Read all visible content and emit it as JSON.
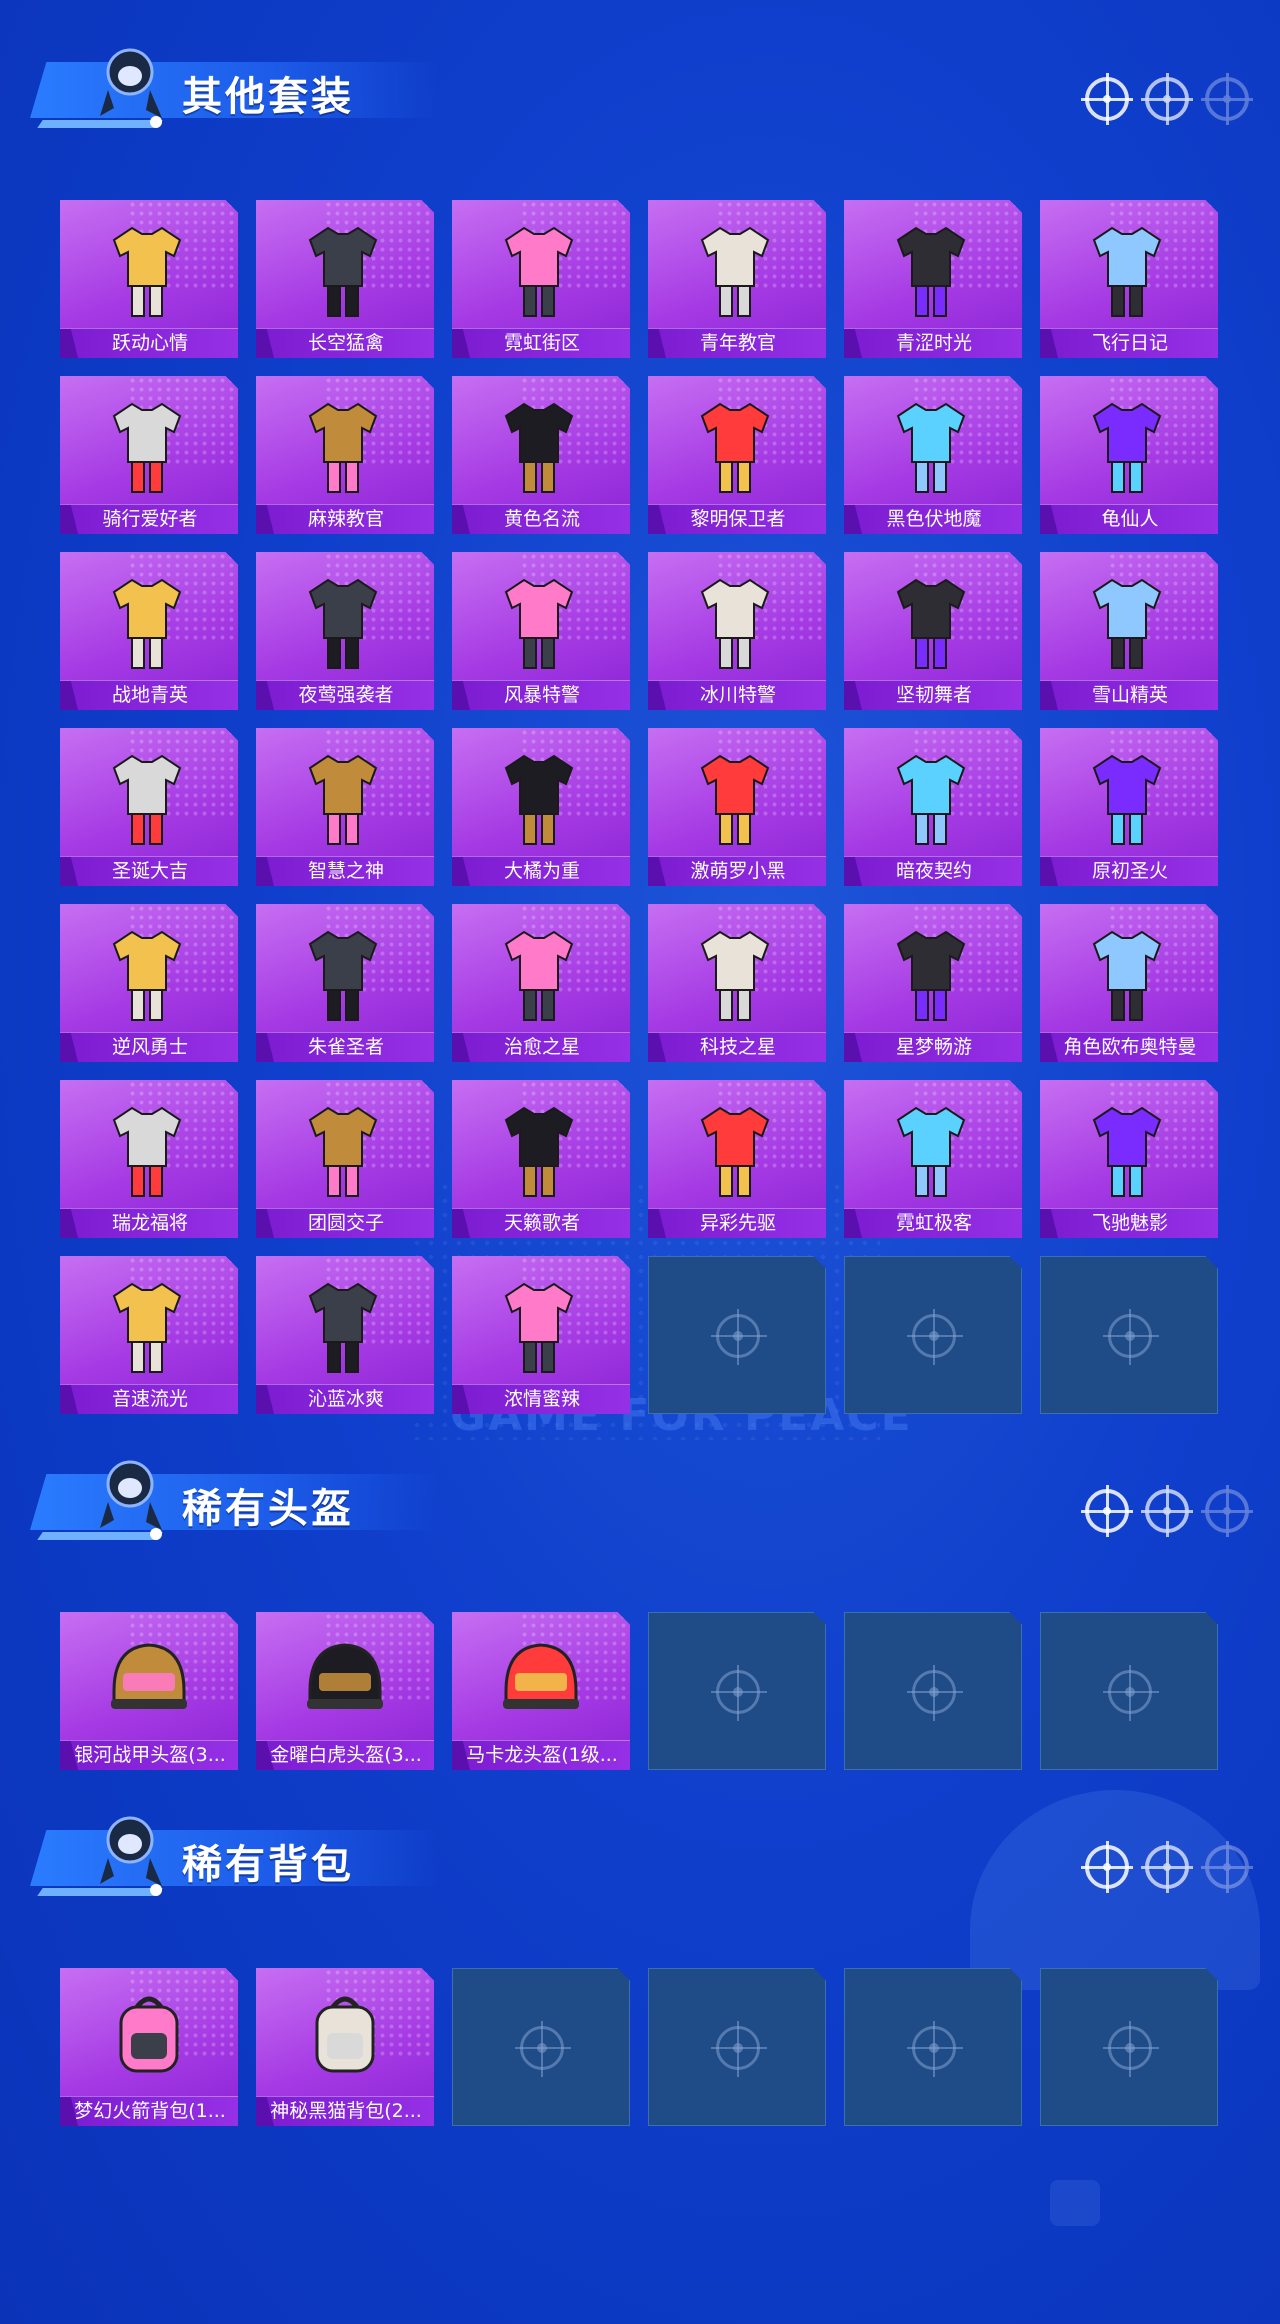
{
  "watermark": "GAME FOR PEACE",
  "colors": {
    "background": "#0f3fcc",
    "card_purple": "#a63be4",
    "label_bar": "#7b1bd0",
    "empty_slot": "#1f4c86",
    "banner": "#2a7cff"
  },
  "sections": [
    {
      "title": "其他套装",
      "items": [
        {
          "label": "跃动心情",
          "icon": "outfit-icon"
        },
        {
          "label": "长空猛禽",
          "icon": "outfit-icon"
        },
        {
          "label": "霓虹街区",
          "icon": "outfit-icon"
        },
        {
          "label": "青年教官",
          "icon": "outfit-icon"
        },
        {
          "label": "青涩时光",
          "icon": "outfit-icon"
        },
        {
          "label": "飞行日记",
          "icon": "outfit-icon"
        },
        {
          "label": "骑行爱好者",
          "icon": "outfit-icon"
        },
        {
          "label": "麻辣教官",
          "icon": "outfit-icon"
        },
        {
          "label": "黄色名流",
          "icon": "outfit-icon"
        },
        {
          "label": "黎明保卫者",
          "icon": "outfit-icon"
        },
        {
          "label": "黑色伏地魔",
          "icon": "outfit-icon"
        },
        {
          "label": "龟仙人",
          "icon": "outfit-icon"
        },
        {
          "label": "战地青英",
          "icon": "outfit-icon"
        },
        {
          "label": "夜莺强袭者",
          "icon": "outfit-icon"
        },
        {
          "label": "风暴特警",
          "icon": "outfit-icon"
        },
        {
          "label": "冰川特警",
          "icon": "outfit-icon"
        },
        {
          "label": "坚韧舞者",
          "icon": "outfit-icon"
        },
        {
          "label": "雪山精英",
          "icon": "outfit-icon"
        },
        {
          "label": "圣诞大吉",
          "icon": "outfit-icon"
        },
        {
          "label": "智慧之神",
          "icon": "outfit-icon"
        },
        {
          "label": "大橘为重",
          "icon": "outfit-icon"
        },
        {
          "label": "激萌罗小黑",
          "icon": "outfit-icon"
        },
        {
          "label": "暗夜契约",
          "icon": "outfit-icon"
        },
        {
          "label": "原初圣火",
          "icon": "outfit-icon"
        },
        {
          "label": "逆风勇士",
          "icon": "outfit-icon"
        },
        {
          "label": "朱雀圣者",
          "icon": "outfit-icon"
        },
        {
          "label": "治愈之星",
          "icon": "outfit-icon"
        },
        {
          "label": "科技之星",
          "icon": "outfit-icon"
        },
        {
          "label": "星梦畅游",
          "icon": "outfit-icon"
        },
        {
          "label": "角色欧布奥特曼",
          "icon": "outfit-icon"
        },
        {
          "label": "瑞龙福将",
          "icon": "outfit-icon"
        },
        {
          "label": "团圆交子",
          "icon": "outfit-icon"
        },
        {
          "label": "天籁歌者",
          "icon": "outfit-icon"
        },
        {
          "label": "异彩先驱",
          "icon": "outfit-icon"
        },
        {
          "label": "霓虹极客",
          "icon": "outfit-icon"
        },
        {
          "label": "飞驰魅影",
          "icon": "outfit-icon"
        },
        {
          "label": "音速流光",
          "icon": "outfit-icon"
        },
        {
          "label": "沁蓝冰爽",
          "icon": "outfit-icon"
        },
        {
          "label": "浓情蜜辣",
          "icon": "outfit-icon"
        }
      ],
      "empty_slots": 3
    },
    {
      "title": "稀有头盔",
      "items": [
        {
          "label": "银河战甲头盔(3...",
          "icon": "helmet-icon"
        },
        {
          "label": "金曜白虎头盔(3...",
          "icon": "helmet-icon"
        },
        {
          "label": "马卡龙头盔(1级...",
          "icon": "helmet-icon"
        }
      ],
      "empty_slots": 3
    },
    {
      "title": "稀有背包",
      "items": [
        {
          "label": "梦幻火箭背包(1...",
          "icon": "backpack-icon"
        },
        {
          "label": "神秘黑猫背包(2...",
          "icon": "backpack-icon"
        }
      ],
      "empty_slots": 4
    }
  ]
}
